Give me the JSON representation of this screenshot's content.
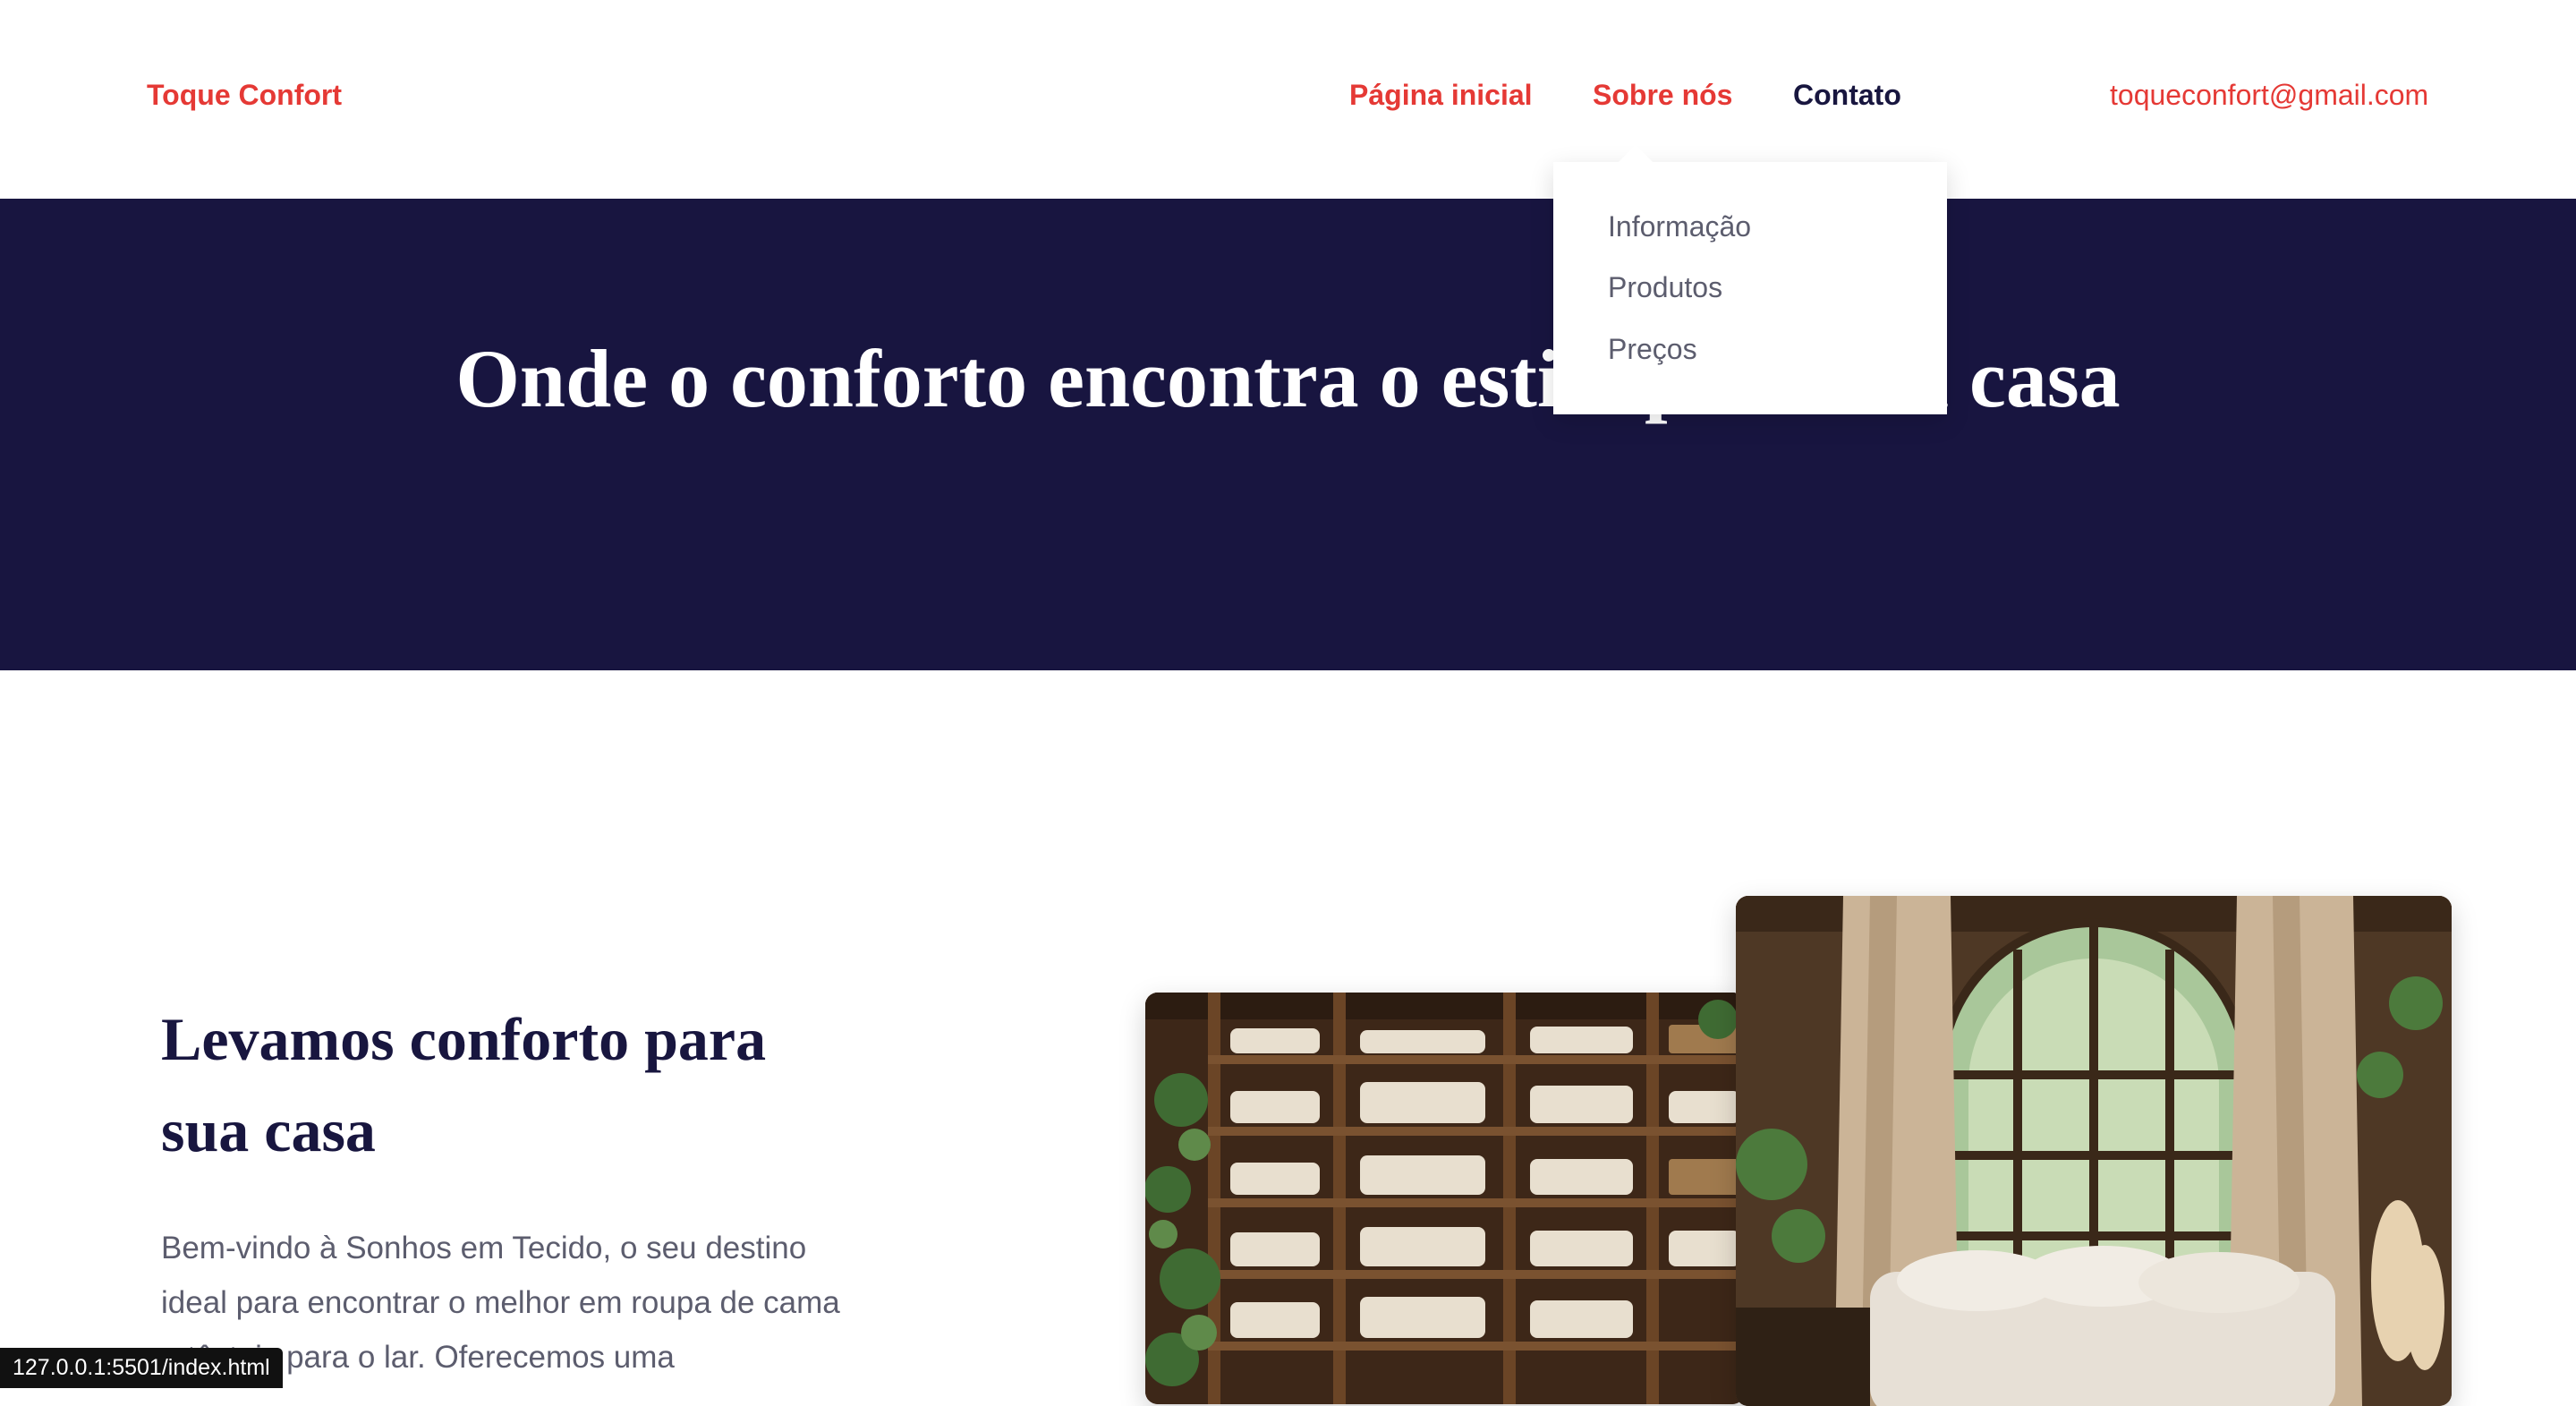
{
  "header": {
    "logo": "Toque Confort",
    "nav": [
      {
        "label": "Página inicial"
      },
      {
        "label": "Sobre nós"
      },
      {
        "label": "Contato"
      }
    ],
    "email": "toqueconfort@gmail.com"
  },
  "dropdown": {
    "items": [
      {
        "label": "Informação"
      },
      {
        "label": "Produtos"
      },
      {
        "label": "Preços"
      }
    ]
  },
  "hero": {
    "title": "Onde o conforto encontra o estilo para sua casa"
  },
  "about": {
    "title": "Levamos conforto para sua casa",
    "text": "Bem-vindo à Sonhos em Tecido, o seu destino ideal para encontrar o melhor em roupa de cama e têxteis para o lar. Oferecemos uma"
  },
  "status_bar": {
    "url": "127.0.0.1:5501/index.html"
  },
  "colors": {
    "accent": "#e53935",
    "navy": "#181540",
    "body_text": "#5c5d6e"
  }
}
